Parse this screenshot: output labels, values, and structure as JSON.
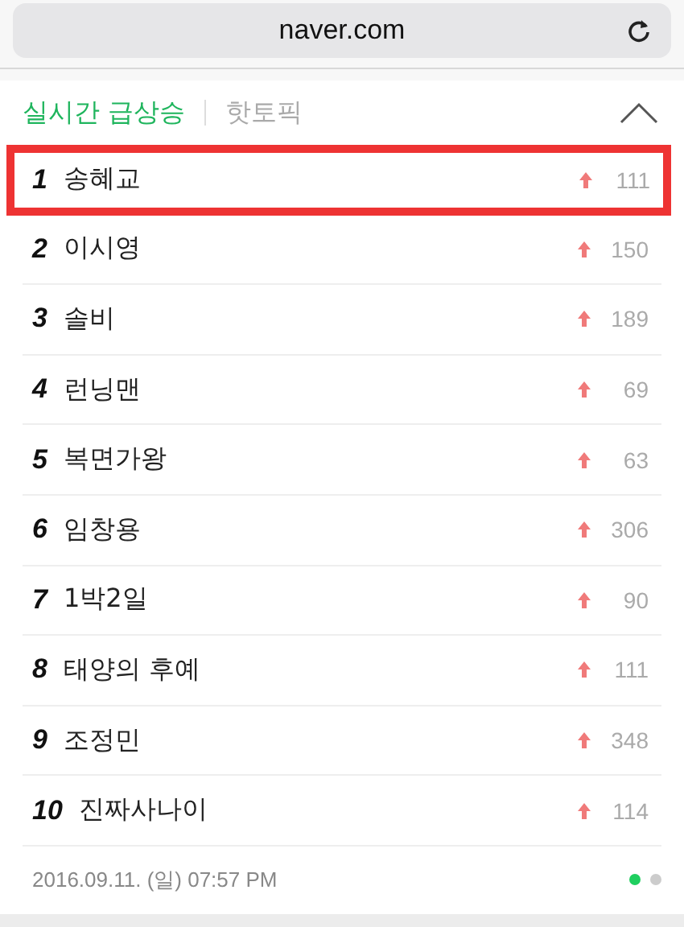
{
  "address_bar": {
    "url": "naver.com"
  },
  "tabs": [
    {
      "label": "실시간 급상승",
      "selected": true
    },
    {
      "label": "핫토픽",
      "selected": false
    }
  ],
  "ranking": [
    {
      "rank": "1",
      "keyword": "송혜교",
      "count": "111",
      "highlighted": true
    },
    {
      "rank": "2",
      "keyword": "이시영",
      "count": "150",
      "highlighted": false
    },
    {
      "rank": "3",
      "keyword": "솔비",
      "count": "189",
      "highlighted": false
    },
    {
      "rank": "4",
      "keyword": "런닝맨",
      "count": "69",
      "highlighted": false
    },
    {
      "rank": "5",
      "keyword": "복면가왕",
      "count": "63",
      "highlighted": false
    },
    {
      "rank": "6",
      "keyword": "임창용",
      "count": "306",
      "highlighted": false
    },
    {
      "rank": "7",
      "keyword": "1박2일",
      "count": "90",
      "highlighted": false
    },
    {
      "rank": "8",
      "keyword": "태양의 후예",
      "count": "111",
      "highlighted": false
    },
    {
      "rank": "9",
      "keyword": "조정민",
      "count": "348",
      "highlighted": false
    },
    {
      "rank": "10",
      "keyword": "진짜사나이",
      "count": "114",
      "highlighted": false
    }
  ],
  "footer": {
    "timestamp": "2016.09.11. (일) 07:57 PM"
  },
  "pager": [
    {
      "selected": true
    },
    {
      "selected": false
    }
  ]
}
